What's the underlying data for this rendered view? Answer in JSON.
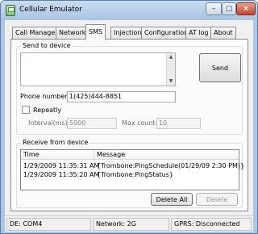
{
  "window": {
    "title": "Cellular Emulator",
    "controls": {
      "minimize": "–",
      "maximize": "□",
      "close": "×"
    }
  },
  "tabs": [
    {
      "label": "Call Manager",
      "active": false
    },
    {
      "label": "Network",
      "active": false
    },
    {
      "label": "SMS",
      "active": true
    },
    {
      "label": "Injection",
      "active": false
    },
    {
      "label": "Configuration",
      "active": false
    },
    {
      "label": "AT log",
      "active": false
    },
    {
      "label": "About",
      "active": false
    }
  ],
  "send_group": {
    "title": "Send to device",
    "message_value": "",
    "send_label": "Send",
    "phone_label": "Phone number:",
    "phone_value": "1(425)444-8851",
    "repeatly_label": "Repeatly",
    "repeatly_checked": false,
    "interval_label": "Interval(ms):",
    "interval_value": "5000",
    "maxcount_label": "Max count:",
    "maxcount_value": "10"
  },
  "receive_group": {
    "title": "Receive from device",
    "columns": [
      "Time",
      "Message"
    ],
    "rows": [
      {
        "time": "1/29/2009 11:35:31 AM",
        "message": "{Trombone:PingSchedule(01/29/09 2:30 PM)}"
      },
      {
        "time": "1/29/2009 11:35:20 AM",
        "message": "{Trombone:PingStatus}"
      }
    ],
    "delete_all_label": "Delete All",
    "delete_label": "Delete"
  },
  "status_bar": {
    "device": "DE: COM4",
    "network": "Network: 2G",
    "gprs": "GPRS: Disconnected"
  },
  "icons": {
    "app": "cellular-emulator-icon",
    "scroll_up": "▲",
    "scroll_down": "▼"
  }
}
